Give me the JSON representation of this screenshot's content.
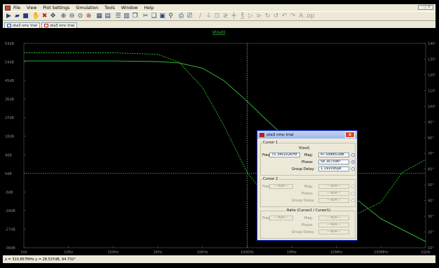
{
  "menubar": {
    "items": [
      {
        "label": "File",
        "accel": "F"
      },
      {
        "label": "View",
        "accel": "V"
      },
      {
        "label": "Plot Settings",
        "accel": "P"
      },
      {
        "label": "Simulation",
        "accel": "S"
      },
      {
        "label": "Tools",
        "accel": "T"
      },
      {
        "label": "Window",
        "accel": "W"
      },
      {
        "label": "Help",
        "accel": "H"
      }
    ],
    "window_controls": "- □ ×"
  },
  "toolbar": {
    "icons": [
      "run-icon",
      "open-icon",
      "save-icon",
      "control-panel-icon",
      "halt-icon",
      "pan-icon",
      "zoom-in-icon",
      "zoom-out-icon",
      "zoom-fit-icon",
      "zoom-cancel-icon",
      "autorange-icon",
      "new-plane-icon",
      "tile-horizontal-icon",
      "tile-vertical-icon",
      "cascade-icon",
      "cut-icon",
      "copy-icon",
      "paste-icon",
      "find-icon",
      "print-icon",
      "print-setup-icon",
      "wire-icon",
      "ground-icon",
      "label-icon",
      "resistor-icon",
      "capacitor-icon",
      "inductor-icon",
      "diode-icon",
      "component-icon",
      "rotate-icon",
      "mirror-icon",
      "undo-icon",
      "redo-icon",
      "text-icon",
      "spice-directive-icon"
    ]
  },
  "tabs": [
    {
      "label": "ota3 nmc trial",
      "icon": "schematic-icon"
    },
    {
      "label": "ota3 nmc trial",
      "icon": "waveform-icon"
    }
  ],
  "plot": {
    "trace_name": "V(out)",
    "trace_color": "#34c234",
    "background": "#000000",
    "grid_color": "#5a5a5a",
    "left_ticks": [
      "63dB",
      "54dB",
      "45dB",
      "36dB",
      "27dB",
      "18dB",
      "9dB",
      "0dB",
      "-9dB",
      "-18dB",
      "-27dB",
      "-36dB"
    ],
    "right_ticks": [
      "140°",
      "130°",
      "120°",
      "110°",
      "100°",
      "90°",
      "80°",
      "70°",
      "60°",
      "50°",
      "40°",
      "30°",
      "20°",
      "10°"
    ],
    "x_ticks": [
      "1Hz",
      "10Hz",
      "100Hz",
      "1KHz",
      "10KHz",
      "100KHz",
      "1MHz",
      "10MHz",
      "100MHz",
      "1GHz"
    ],
    "cursor_x_label": "100KHz"
  },
  "chart_data": {
    "type": "line",
    "title": "V(out)",
    "xlabel": "",
    "ylabel": "",
    "x_scale": "log",
    "xlim": [
      "1Hz",
      "1GHz"
    ],
    "ylim_left_db": [
      -36,
      63
    ],
    "ylim_right_deg": [
      10,
      140
    ],
    "grid": true,
    "series": [
      {
        "name": "",
        "kind": "magnitude (dB)",
        "style": "solid",
        "x_hz": [
          1,
          10,
          100,
          1000,
          3000,
          10000,
          30000,
          100000,
          300000,
          1000000,
          10000000,
          30000000,
          100000000,
          1000000000
        ],
        "y": [
          54.5,
          54.5,
          54.5,
          54.2,
          53.5,
          51,
          45,
          35,
          25,
          15,
          -5,
          -13,
          -22,
          -33
        ]
      },
      {
        "name": "",
        "kind": "phase (deg)",
        "style": "dashed",
        "x_hz": [
          1,
          10,
          100,
          1000,
          3000,
          10000,
          30000,
          100000,
          300000,
          1000000,
          3000000,
          10000000,
          100000000,
          300000000,
          1000000000
        ],
        "y": [
          134,
          134,
          134,
          133,
          128,
          112,
          88,
          58,
          41,
          31,
          27,
          25,
          39,
          58,
          66
        ]
      }
    ]
  },
  "dialog": {
    "title": "ota3 nmc trial",
    "close": "x",
    "cursor1": {
      "group_label": "Cursor 1",
      "trace": "V(out)",
      "freq_label": "Freq:",
      "freq_value": "75.345202KHz",
      "mag_label": "Mag:",
      "mag_value": "47.098652dB",
      "phase_label": "Phase:",
      "phase_value": "58.307596°",
      "gd_label": "Group Delay:",
      "gd_value": "1.191095µs"
    },
    "cursor2": {
      "group_label": "Cursor 2",
      "freq_label": "Freq:",
      "freq_value": "---N/A---",
      "mag_label": "Mag:",
      "mag_value": "---N/A---",
      "phase_label": "Phase:",
      "phase_value": "---N/A---",
      "gd_label": "Group Delay:",
      "gd_value": "---N/A---"
    },
    "ratio": {
      "group_label": "Ratio (Cursor2 / Cursor1)",
      "freq_label": "Freq:",
      "freq_value": "---N/A---",
      "mag_label": "Mag:",
      "mag_value": "---N/A---",
      "phase_label": "Phase:",
      "phase_value": "---N/A---",
      "gd_label": "Group Delay:",
      "gd_value": "---N/A---"
    }
  },
  "status": {
    "text": "x = 310.857MHz   y = 28.537dB, 94.732°"
  }
}
